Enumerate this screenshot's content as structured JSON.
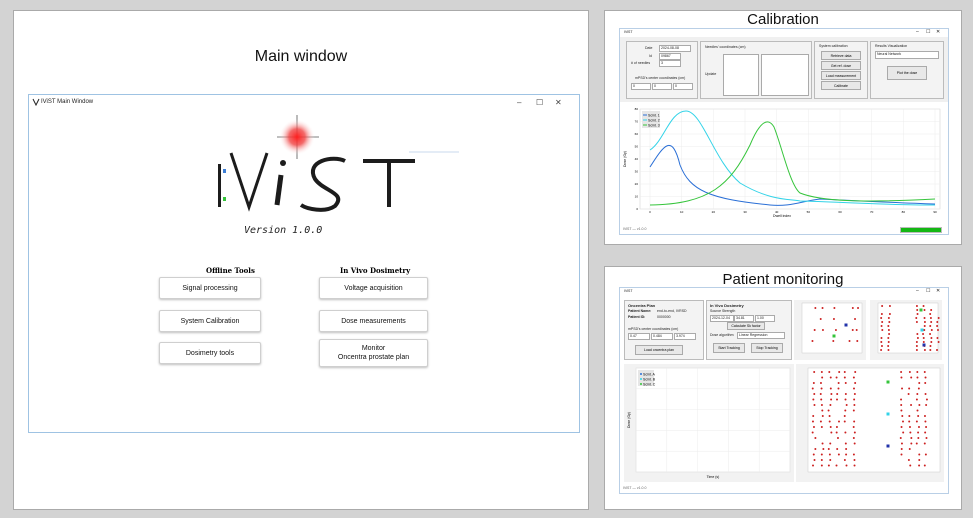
{
  "main_panel": {
    "title": "Main window",
    "window": {
      "title": "IViST Main Window",
      "logo_text": "IViST",
      "version": "Version 1.0.0",
      "offline": {
        "heading": "Offline Tools",
        "buttons": [
          "Signal processing",
          "System Calibration",
          "Dosimetry tools"
        ]
      },
      "invivo": {
        "heading": "In Vivo Dosimetry",
        "buttons": [
          "Voltage acquisition",
          "Dose measurements"
        ],
        "monitor_line1": "Monitor",
        "monitor_line2": "Oncentra prostate plan"
      }
    }
  },
  "calibration_panel": {
    "title": "Calibration",
    "window_title": "IViST",
    "date_label": "Date",
    "date_value": "2024-08-08",
    "id_label": "Id",
    "id_value": "09867",
    "needles_label": "# of needles",
    "needles_value": "3",
    "mpsd_label": "mPSD's center coordinates (cm)",
    "mpsd_values": [
      "0",
      "0",
      "0"
    ],
    "needle_coords_label": "Needles' coordinates (cm)",
    "update_label": "Update",
    "system_calibration": {
      "heading": "System calibration",
      "buttons": [
        "Retrieve data",
        "Get ref. dose",
        "Load measurement",
        "Calibrate"
      ]
    },
    "results": {
      "heading": "Results Visualization",
      "select_value": "Neural Network",
      "plot_button": "Plot the dose"
    },
    "legend": [
      "Scint. 1",
      "Scint. 2",
      "Scint. 3"
    ],
    "xlabel": "Dwell index",
    "ylabel": "Dose (Gy)",
    "yticks": [
      "80",
      "70",
      "60",
      "50",
      "40",
      "30",
      "20",
      "10",
      "0"
    ],
    "xticks": [
      "0",
      "10",
      "20",
      "30",
      "40",
      "50",
      "60",
      "70",
      "80",
      "90"
    ],
    "status": "IViST — v1.0.0",
    "progress_label": "100%",
    "progress": 1.0
  },
  "monitor_panel": {
    "title": "Patient monitoring",
    "window_title": "IViST",
    "oncentra": {
      "heading": "Oncentra Plan",
      "patient_name_label": "Patient Name:",
      "patient_name_value": "end-to-end, IVRSD",
      "patient_id_label": "Patient ID:",
      "patient_id_value": "0000000",
      "mpsd_label": "mPSD's center coordinates (cm)",
      "mpsd_values": [
        "0.47",
        "0.484",
        "3.974"
      ],
      "load_button": "Load oncentra plan"
    },
    "invivo": {
      "heading": "In Vivo Dosimetry",
      "source_label": "Source Strength",
      "source_values": [
        "2024-12-04",
        "34.81",
        "1.00"
      ],
      "calc_button": "Calculate Sk factor",
      "algo_label": "Dose algorithm",
      "algo_value": "Linear Regression",
      "start_button": "Start Tracking",
      "stop_button": "Stop Tracking"
    },
    "legend": [
      "Scint. A",
      "Scint. B",
      "Scint. C"
    ],
    "xlabel": "Time (s)",
    "ylabel": "Dose (Gy)",
    "status": "IViST — v1.0.0"
  },
  "colors": {
    "background": "#d3d3d3",
    "window_border": "#9fc3e3",
    "curve_blue": "#2a6fd6",
    "curve_cyan": "#33d3e8",
    "curve_green": "#35c43b",
    "dots_red": "#cc1f1f",
    "progress_green": "#14b714"
  }
}
